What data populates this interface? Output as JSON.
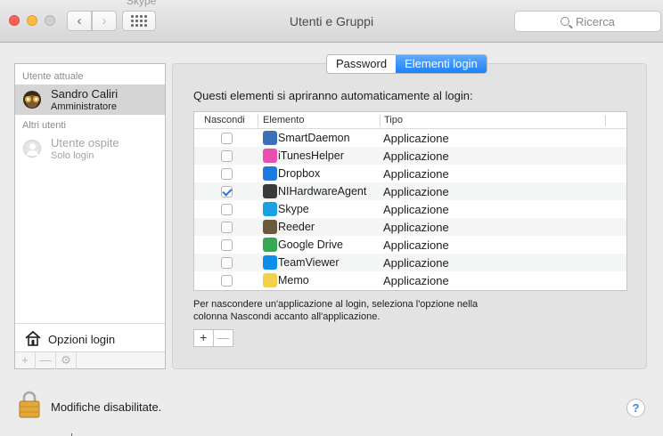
{
  "window": {
    "title": "Utenti e Gruppi",
    "ghost_title": "Skype"
  },
  "toolbar": {
    "back_icon": "chevron-left-icon",
    "forward_icon": "chevron-right-icon",
    "grid_icon": "show-all-grid-icon",
    "search_placeholder": "Ricerca"
  },
  "sidebar": {
    "current_label": "Utente attuale",
    "others_label": "Altri utenti",
    "users": [
      {
        "name": "Sandro Caliri",
        "role": "Amministratore",
        "selected": true
      },
      {
        "name": "Utente ospite",
        "role": "Solo login",
        "selected": false
      }
    ],
    "login_options": "Opzioni login",
    "bottom_buttons": [
      "+",
      "—",
      "⚙"
    ]
  },
  "tabs": [
    {
      "label": "Password",
      "active": false
    },
    {
      "label": "Elementi login",
      "active": true
    }
  ],
  "main": {
    "intro": "Questi elementi si apriranno automaticamente al login:",
    "columns": [
      "Nascondi",
      "Elemento",
      "Tipo"
    ],
    "items": [
      {
        "name": "SmartDaemon",
        "type": "Applicazione",
        "hidden": false,
        "icon": "smartdaemon-icon",
        "color": "#3d6fb6"
      },
      {
        "name": "iTunesHelper",
        "type": "Applicazione",
        "hidden": false,
        "icon": "itunes-icon",
        "color": "#e94fb0"
      },
      {
        "name": "Dropbox",
        "type": "Applicazione",
        "hidden": false,
        "icon": "dropbox-icon",
        "color": "#1f7ae0"
      },
      {
        "name": "NIHardwareAgent",
        "type": "Applicazione",
        "hidden": true,
        "icon": "nihardwareagent-icon",
        "color": "#3a3a3a"
      },
      {
        "name": "Skype",
        "type": "Applicazione",
        "hidden": false,
        "icon": "skype-icon",
        "color": "#1ba1e2"
      },
      {
        "name": "Reeder",
        "type": "Applicazione",
        "hidden": false,
        "icon": "reeder-icon",
        "color": "#6b5a3e"
      },
      {
        "name": "Google Drive",
        "type": "Applicazione",
        "hidden": false,
        "icon": "google-drive-icon",
        "color": "#34a853"
      },
      {
        "name": "TeamViewer",
        "type": "Applicazione",
        "hidden": false,
        "icon": "teamviewer-icon",
        "color": "#0e8ee9"
      },
      {
        "name": "Memo",
        "type": "Applicazione",
        "hidden": false,
        "icon": "memo-icon",
        "color": "#f2d24b"
      }
    ],
    "help_line1": "Per nascondere un'applicazione al login, seleziona l'opzione nella",
    "help_line2": "colonna Nascondi accanto all'applicazione.",
    "add_label": "+",
    "remove_label": "—"
  },
  "footer": {
    "lock_text": "Modifiche disabilitate.",
    "help_label": "?"
  }
}
